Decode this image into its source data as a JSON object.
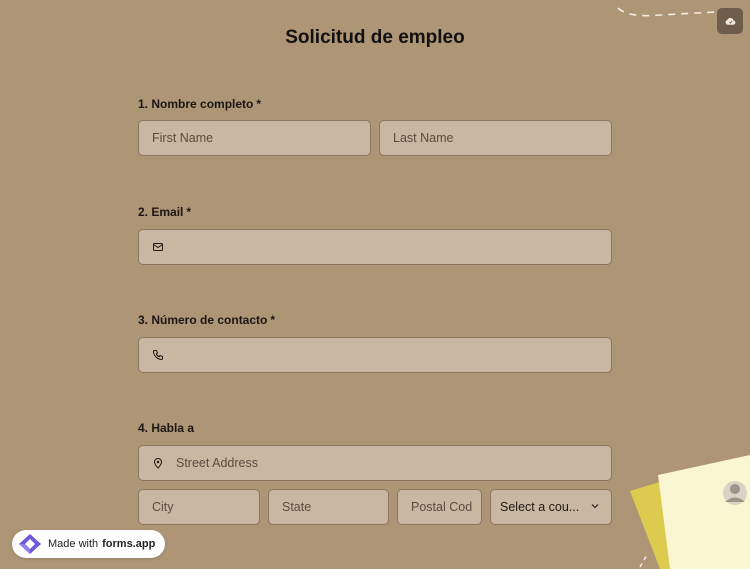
{
  "form": {
    "title": "Solicitud de empleo"
  },
  "questions": [
    {
      "label": "1.  Nombre completo",
      "required_mark": "*"
    },
    {
      "label": "2. Email",
      "required_mark": "*"
    },
    {
      "label": "3. Número de contacto",
      "required_mark": "*"
    },
    {
      "label": "4. Habla a",
      "required_mark": ""
    }
  ],
  "fields": {
    "first_name": {
      "placeholder": "First Name",
      "value": ""
    },
    "last_name": {
      "placeholder": "Last Name",
      "value": ""
    },
    "email": {
      "placeholder": "",
      "value": ""
    },
    "phone": {
      "placeholder": "",
      "value": ""
    },
    "street": {
      "placeholder": "Street Address",
      "value": ""
    },
    "city": {
      "placeholder": "City",
      "value": ""
    },
    "state": {
      "placeholder": "State",
      "value": ""
    },
    "postal": {
      "placeholder": "Postal Cod",
      "value": ""
    },
    "country": {
      "selected": "Select a cou..."
    }
  },
  "icons": {
    "email": "mail-icon",
    "phone": "phone-icon",
    "street": "location-pin-icon",
    "country": "chevron-down-icon",
    "save": "cloud-icon"
  },
  "badge": {
    "prefix": "Made with",
    "brand": "forms.app"
  },
  "colors": {
    "background": "#ae9576",
    "field_bg": "#c9b7a2",
    "field_border": "#8c7660",
    "badge_accent": "#6b5ad8"
  }
}
